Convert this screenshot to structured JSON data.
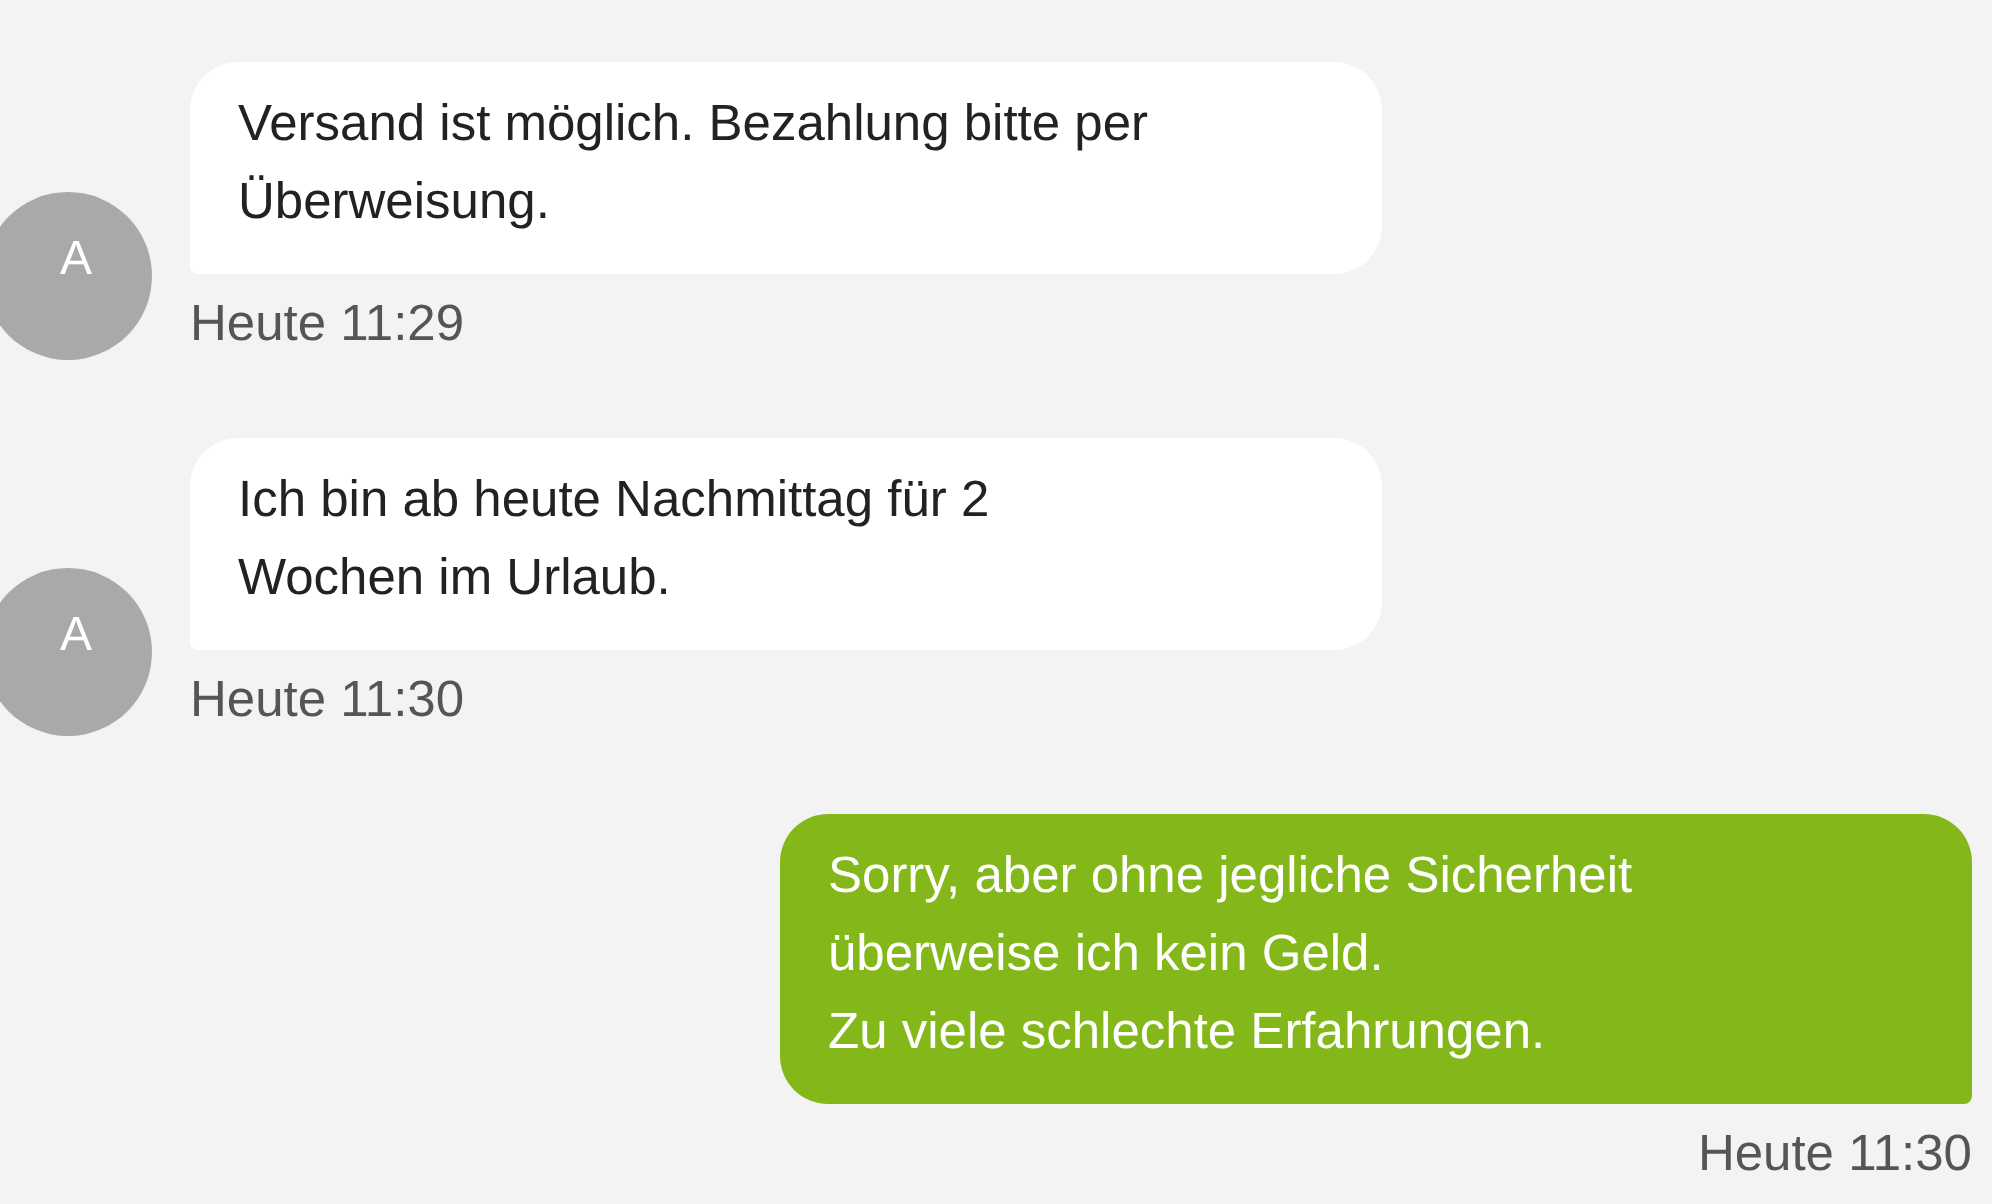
{
  "messages": [
    {
      "kind": "incoming",
      "avatar": "A",
      "text": "Versand ist möglich. Bezahlung bitte per\nÜberweisung.",
      "time": "Heute 11:29"
    },
    {
      "kind": "incoming",
      "avatar": "A",
      "text": "Ich bin ab heute Nachmittag für 2\nWochen im Urlaub.",
      "time": "Heute 11:30"
    },
    {
      "kind": "outgoing",
      "text": "Sorry, aber ohne jegliche Sicherheit\nüberweise ich kein Geld.\nZu viele schlechte Erfahrungen.",
      "time": "Heute 11:30"
    }
  ]
}
